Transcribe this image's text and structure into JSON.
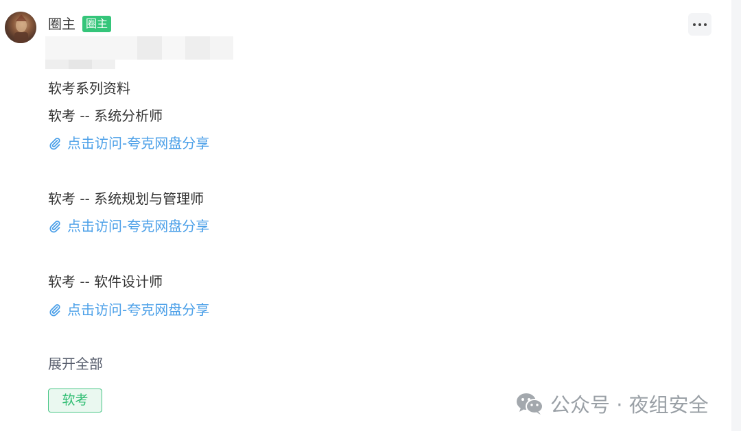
{
  "author": {
    "name": "圈主",
    "badge": "圈主"
  },
  "post": {
    "intro": "软考系列资料",
    "sections": [
      {
        "title": "软考 -- 系统分析师",
        "link_text": "点击访问-夸克网盘分享"
      },
      {
        "title": "软考 -- 系统规划与管理师",
        "link_text": "点击访问-夸克网盘分享"
      },
      {
        "title": "软考 -- 软件设计师",
        "link_text": "点击访问-夸克网盘分享"
      }
    ],
    "expand_label": "展开全部",
    "tag": "软考"
  },
  "watermark": {
    "text": "公众号 · 夜组安全",
    "icon": "wechat-icon"
  },
  "colors": {
    "badge_bg": "#35c57a",
    "link": "#4a9fe8",
    "tag_border": "#44c483",
    "tag_text": "#2fbd72"
  }
}
